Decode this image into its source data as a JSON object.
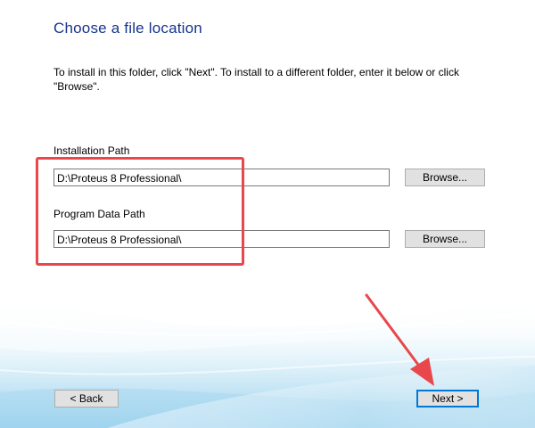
{
  "dialog": {
    "title": "Choose a file location",
    "instructions": "To install in this folder, click \"Next\". To install to a different folder, enter it below or click \"Browse\"."
  },
  "installation_path": {
    "label": "Installation Path",
    "value": "D:\\Proteus 8 Professional\\",
    "browse_label": "Browse..."
  },
  "program_data_path": {
    "label": "Program Data Path",
    "value": "D:\\Proteus 8 Professional\\",
    "browse_label": "Browse..."
  },
  "footer": {
    "back_label": "< Back",
    "next_label": "Next >"
  },
  "colors": {
    "title": "#16348c",
    "annotation": "#e8474b",
    "default_button_border": "#0078d7"
  },
  "annotations": {
    "highlight_box_target": "path fields",
    "arrow_target": "next-button"
  }
}
